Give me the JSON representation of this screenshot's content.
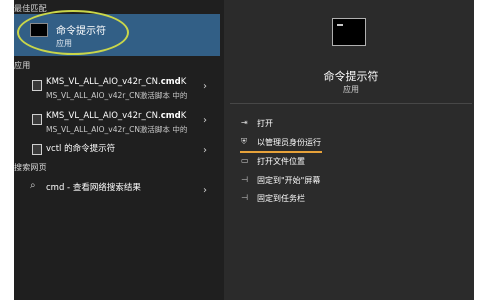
{
  "left": {
    "best_match_label": "最佳匹配",
    "best_match": {
      "title": "命令提示符",
      "subtitle": "应用"
    },
    "apps_label": "应用",
    "apps": [
      {
        "title_prefix": "KMS_VL_ALL_AIO_v42r_CN.",
        "title_bold": "cmd",
        "title_suffix": "K",
        "subtitle": "MS_VL_ALL_AIO_v42r_CN激活脚本 中的"
      },
      {
        "title_prefix": "KMS_VL_ALL_AIO_v42r_CN.",
        "title_bold": "cmd",
        "title_suffix": "K",
        "subtitle": "MS_VL_ALL_AIO_v42r_CN激活脚本 中的"
      },
      {
        "title_prefix": "vctl 的命令提示符",
        "title_bold": "",
        "title_suffix": "",
        "subtitle": ""
      }
    ],
    "web_label": "搜索网页",
    "web_result": "cmd - 查看网络搜索结果"
  },
  "right": {
    "title": "命令提示符",
    "subtitle": "应用",
    "actions": [
      {
        "label": "打开",
        "icon": "open-icon"
      },
      {
        "label": "以管理员身份运行",
        "icon": "shield-admin-icon"
      },
      {
        "label": "打开文件位置",
        "icon": "folder-icon"
      },
      {
        "label": "固定到\"开始\"屏幕",
        "icon": "pin-icon"
      },
      {
        "label": "固定到任务栏",
        "icon": "pin-icon"
      }
    ]
  },
  "colors": {
    "selected_bg": "#325f86",
    "highlight_oval": "#c9d64a",
    "underline": "#e7a23a"
  }
}
